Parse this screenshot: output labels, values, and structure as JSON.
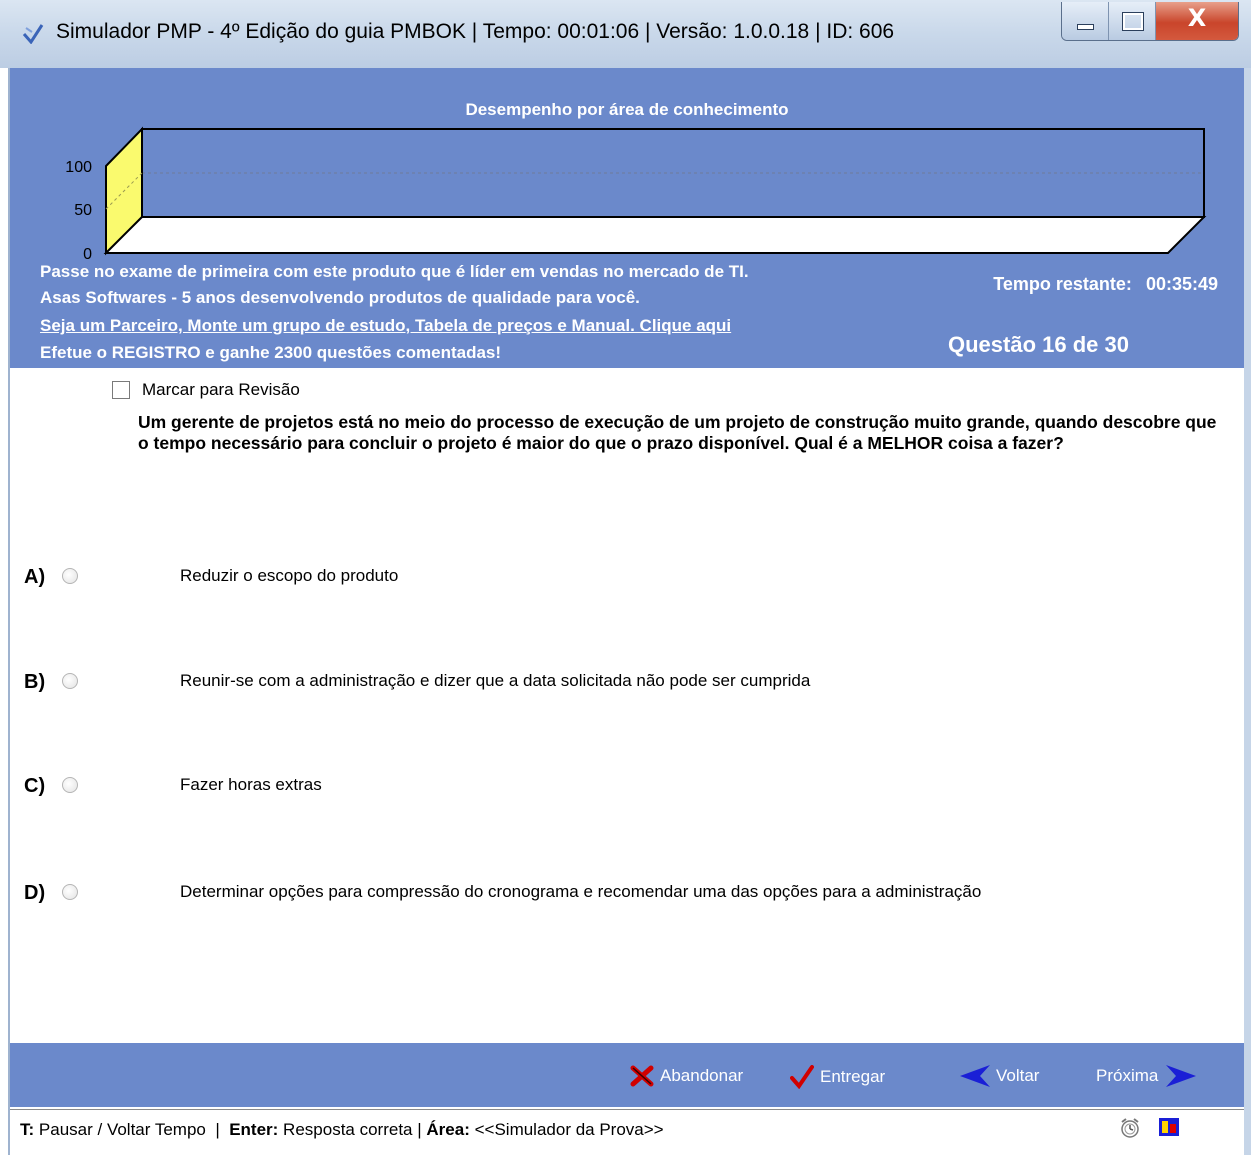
{
  "window": {
    "title": "Simulador PMP - 4º Edição do guia PMBOK | Tempo: 00:01:06 |  Versão: 1.0.0.18 | ID: 606",
    "close_label": "X"
  },
  "chart": {
    "title": "Desempenho por área de conhecimento"
  },
  "chart_data": {
    "type": "bar",
    "title": "Desempenho por área de conhecimento",
    "xlabel": "",
    "ylabel": "",
    "ylim": [
      0,
      100
    ],
    "yticks": [
      "100",
      "50",
      "0"
    ],
    "categories": [],
    "values": [],
    "grid": true,
    "colors": {
      "left_wall": "#fafa6e",
      "back_wall": "#6b89cb",
      "floor": "#ffffff"
    }
  },
  "promo": {
    "line1": "Passe no exame de primeira com este produto que é líder em vendas no mercado de TI.",
    "line2": "Asas Softwares - 5 anos desenvolvendo produtos de qualidade para você.",
    "link": "Seja um Parceiro, Monte um grupo de estudo, Tabela de preços e Manual. Clique aqui",
    "line4": "Efetue o REGISTRO e ganhe 2300 questões comentadas!"
  },
  "timer": {
    "label": "Tempo restante:",
    "value": "00:35:49"
  },
  "progress": {
    "label": "Questão 16 de 30"
  },
  "review": {
    "label": "Marcar para Revisão",
    "checked": false
  },
  "question": {
    "text": "Um gerente de projetos está no meio do processo de execução de um projeto de construção muito grande, quando descobre que o tempo necessário para concluir o projeto é maior do que o prazo disponível. Qual é a MELHOR coisa a fazer?"
  },
  "options": [
    {
      "letter": "A)",
      "text": "Reduzir o escopo do produto"
    },
    {
      "letter": "B)",
      "text": "Reunir-se com a administração e dizer que a data solicitada não pode ser cumprida"
    },
    {
      "letter": "C)",
      "text": "Fazer horas extras"
    },
    {
      "letter": "D)",
      "text": "Determinar opções para compressão do cronograma e recomendar uma das opções para a administração"
    }
  ],
  "nav": {
    "abandon": "Abandonar",
    "submit": "Entregar",
    "back": "Voltar",
    "next": "Próxima"
  },
  "status": {
    "key1": "T:",
    "desc1": "Pausar / Voltar Tempo",
    "sep": "|",
    "key2": "Enter:",
    "desc2": "Resposta correta",
    "key3": "Área:",
    "desc3": "<<Simulador da Prova>>"
  },
  "colors": {
    "panel_blue": "#6b89cb",
    "accent_yellow": "#fafa6e",
    "abandon_red": "#d10000",
    "nav_arrow_blue": "#1a1fd6"
  }
}
